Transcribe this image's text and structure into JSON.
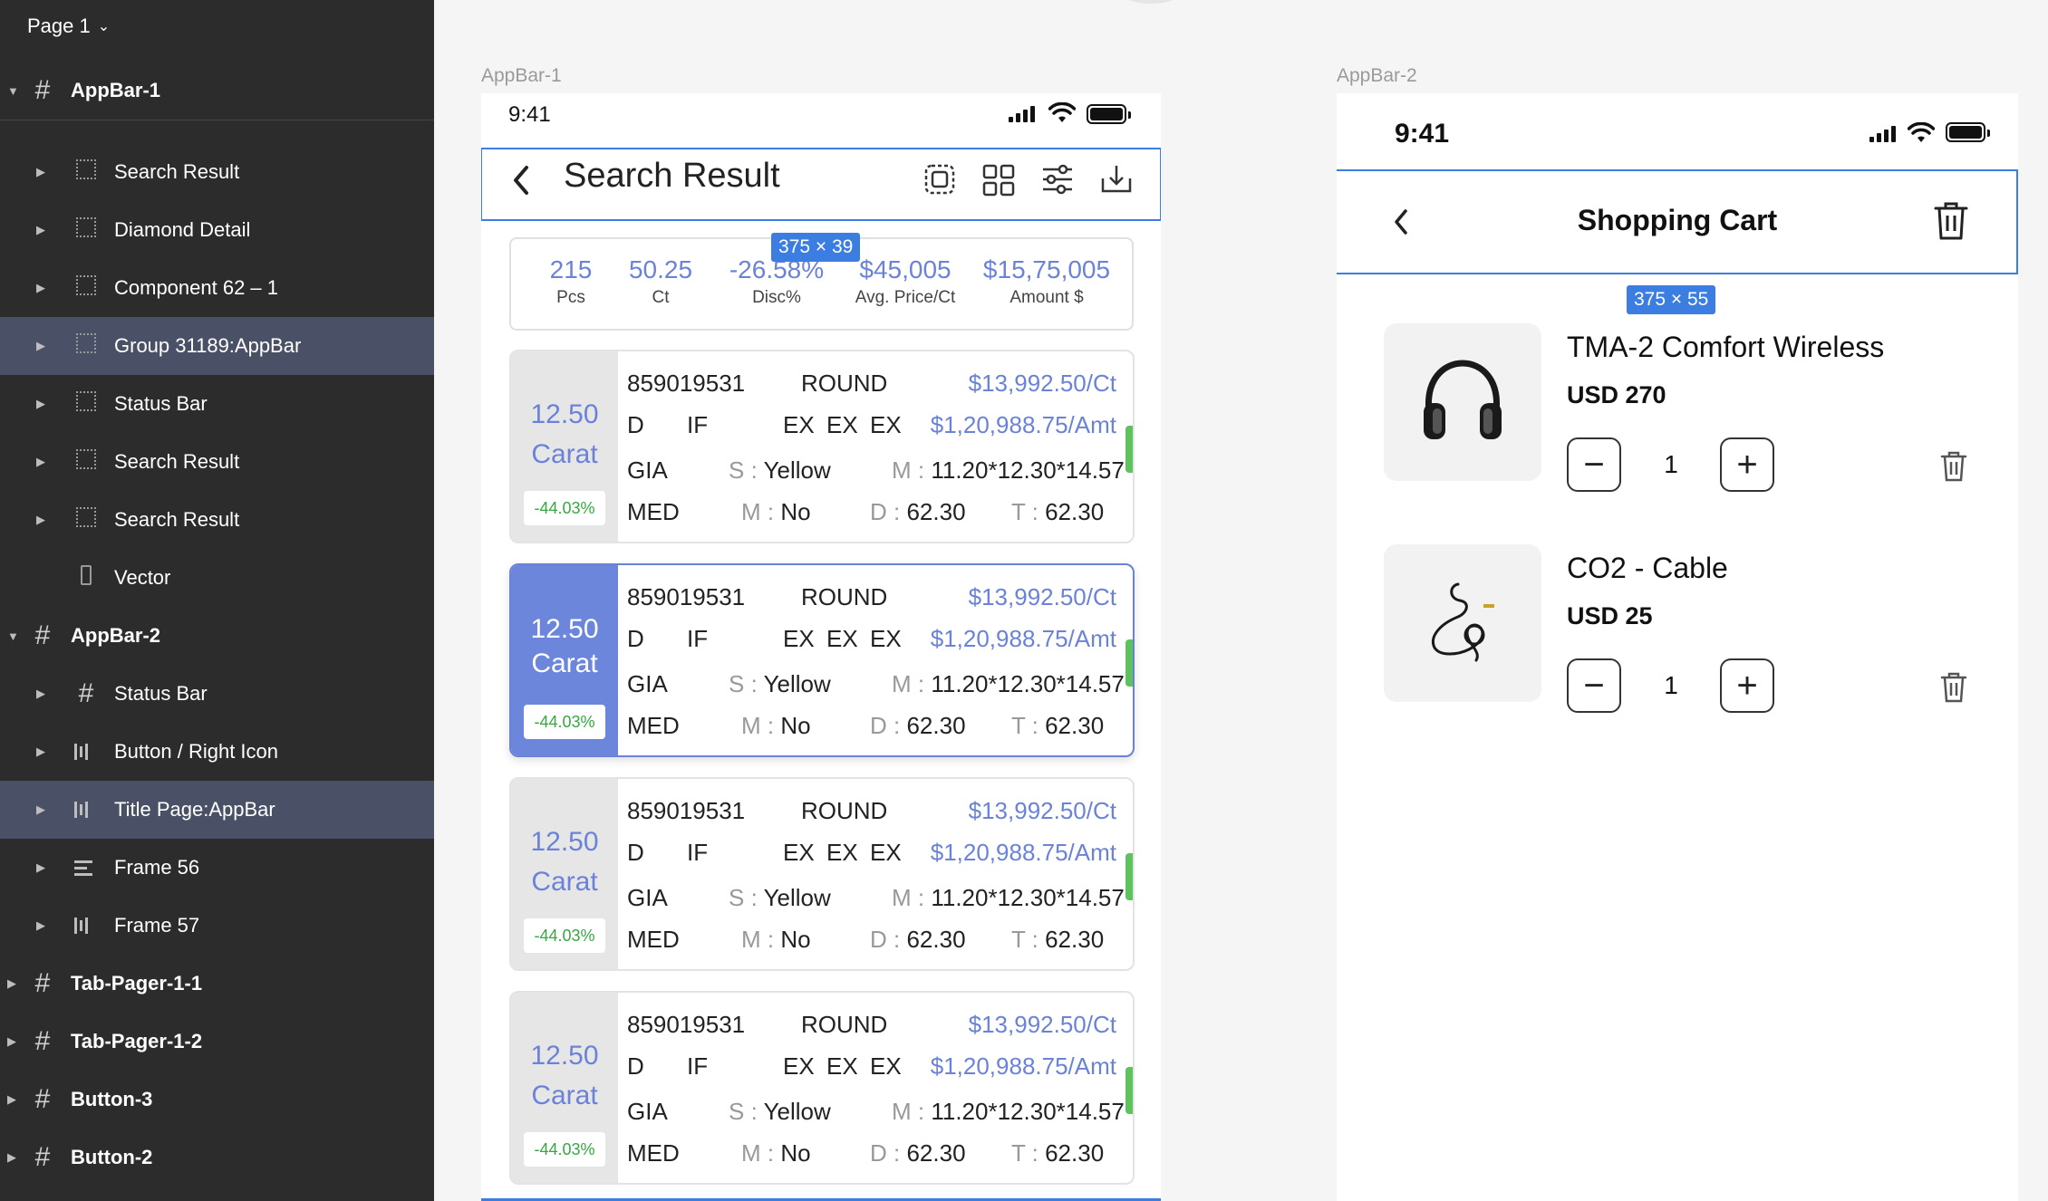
{
  "sidebar": {
    "page_label": "Page 1",
    "layers": [
      {
        "label": "AppBar-1",
        "icon": "frame-hash-icon",
        "level": 0,
        "expanded": true,
        "selected": false
      },
      {
        "label": "Search Result",
        "icon": "group-dotted-icon",
        "level": 1,
        "expanded": false,
        "selected": false
      },
      {
        "label": "Diamond Detail",
        "icon": "group-dotted-icon",
        "level": 1,
        "expanded": false,
        "selected": false
      },
      {
        "label": "Component 62 – 1",
        "icon": "group-dotted-icon",
        "level": 1,
        "expanded": false,
        "selected": false
      },
      {
        "label": "Group 31189:AppBar",
        "icon": "group-dotted-icon",
        "level": 1,
        "expanded": false,
        "selected": true
      },
      {
        "label": "Status Bar",
        "icon": "group-dotted-icon",
        "level": 1,
        "expanded": false,
        "selected": false
      },
      {
        "label": "Search Result",
        "icon": "group-dotted-icon",
        "level": 1,
        "expanded": false,
        "selected": false
      },
      {
        "label": "Search Result",
        "icon": "group-dotted-icon",
        "level": 1,
        "expanded": false,
        "selected": false
      },
      {
        "label": "Vector",
        "icon": "vector-icon",
        "level": 1,
        "expanded": null,
        "selected": false
      },
      {
        "label": "AppBar-2",
        "icon": "frame-hash-icon",
        "level": 0,
        "expanded": true,
        "selected": false
      },
      {
        "label": "Status Bar",
        "icon": "frame-hash-icon",
        "level": 1,
        "expanded": false,
        "selected": false
      },
      {
        "label": "Button / Right Icon",
        "icon": "auto-layout-horizontal-icon",
        "level": 1,
        "expanded": false,
        "selected": false
      },
      {
        "label": "Title Page:AppBar",
        "icon": "auto-layout-horizontal-icon",
        "level": 1,
        "expanded": false,
        "selected": true
      },
      {
        "label": "Frame 56",
        "icon": "auto-layout-vertical-icon",
        "level": 1,
        "expanded": false,
        "selected": false
      },
      {
        "label": "Frame 57",
        "icon": "auto-layout-horizontal-icon",
        "level": 1,
        "expanded": false,
        "selected": false
      },
      {
        "label": "Tab-Pager-1-1",
        "icon": "frame-hash-icon",
        "level": 0,
        "expanded": false,
        "selected": false
      },
      {
        "label": "Tab-Pager-1-2",
        "icon": "frame-hash-icon",
        "level": 0,
        "expanded": false,
        "selected": false
      },
      {
        "label": "Button-3",
        "icon": "frame-hash-icon",
        "level": 0,
        "expanded": false,
        "selected": false
      },
      {
        "label": "Button-2",
        "icon": "frame-hash-icon",
        "level": 0,
        "expanded": false,
        "selected": false
      }
    ]
  },
  "frame1": {
    "label": "AppBar-1",
    "status_time": "9:41",
    "title": "Search Result",
    "dimension_badge": "375 × 39",
    "icons": [
      "select-frame-icon",
      "grid-icon",
      "filter-sliders-icon",
      "download-icon"
    ],
    "summary": [
      {
        "value": "215",
        "unit": "Pcs"
      },
      {
        "value": "50.25",
        "unit": "Ct"
      },
      {
        "value": "-26.58%",
        "unit": "Disc%"
      },
      {
        "value": "$45,005",
        "unit": "Avg. Price/Ct"
      },
      {
        "value": "$15,75,005",
        "unit": "Amount $"
      }
    ],
    "results": [
      {
        "carat": "12.50",
        "carat_label": "Carat",
        "disc": "-44.03%",
        "id": "859019531",
        "shape": "ROUND",
        "price_ct": "$13,992.50/Ct",
        "color": "D",
        "clarity": "IF",
        "cut": "EX",
        "polish": "EX",
        "symmetry": "EX",
        "amount": "$1,20,988.75/Amt",
        "lab": "GIA",
        "s_label": "S :",
        "s_value": "Yellow",
        "m_label": "M :",
        "m_value": "11.20*12.30*14.57",
        "fluor": "MED",
        "m2_label": "M :",
        "m2_value": "No",
        "d_label": "D :",
        "d_value": "62.30",
        "t_label": "T :",
        "t_value": "62.30",
        "active": false
      },
      {
        "carat": "12.50",
        "carat_label": "Carat",
        "disc": "-44.03%",
        "id": "859019531",
        "shape": "ROUND",
        "price_ct": "$13,992.50/Ct",
        "color": "D",
        "clarity": "IF",
        "cut": "EX",
        "polish": "EX",
        "symmetry": "EX",
        "amount": "$1,20,988.75/Amt",
        "lab": "GIA",
        "s_label": "S :",
        "s_value": "Yellow",
        "m_label": "M :",
        "m_value": "11.20*12.30*14.57",
        "fluor": "MED",
        "m2_label": "M :",
        "m2_value": "No",
        "d_label": "D :",
        "d_value": "62.30",
        "t_label": "T :",
        "t_value": "62.30",
        "active": true
      },
      {
        "carat": "12.50",
        "carat_label": "Carat",
        "disc": "-44.03%",
        "id": "859019531",
        "shape": "ROUND",
        "price_ct": "$13,992.50/Ct",
        "color": "D",
        "clarity": "IF",
        "cut": "EX",
        "polish": "EX",
        "symmetry": "EX",
        "amount": "$1,20,988.75/Amt",
        "lab": "GIA",
        "s_label": "S :",
        "s_value": "Yellow",
        "m_label": "M :",
        "m_value": "11.20*12.30*14.57",
        "fluor": "MED",
        "m2_label": "M :",
        "m2_value": "No",
        "d_label": "D :",
        "d_value": "62.30",
        "t_label": "T :",
        "t_value": "62.30",
        "active": false
      },
      {
        "carat": "12.50",
        "carat_label": "Carat",
        "disc": "-44.03%",
        "id": "859019531",
        "shape": "ROUND",
        "price_ct": "$13,992.50/Ct",
        "color": "D",
        "clarity": "IF",
        "cut": "EX",
        "polish": "EX",
        "symmetry": "EX",
        "amount": "$1,20,988.75/Amt",
        "lab": "GIA",
        "s_label": "S :",
        "s_value": "Yellow",
        "m_label": "M :",
        "m_value": "11.20*12.30*14.57",
        "fluor": "MED",
        "m2_label": "M :",
        "m2_value": "No",
        "d_label": "D :",
        "d_value": "62.30",
        "t_label": "T :",
        "t_value": "62.30",
        "active": false
      }
    ]
  },
  "frame2": {
    "label": "AppBar-2",
    "status_time": "9:41",
    "title": "Shopping Cart",
    "dimension_badge": "375 × 55",
    "items": [
      {
        "name": "TMA-2 Comfort Wireless",
        "price": "USD 270",
        "qty": "1",
        "image": "headphones-icon"
      },
      {
        "name": "CO2 - Cable",
        "price": "USD 25",
        "qty": "1",
        "image": "cable-icon"
      }
    ]
  },
  "colors": {
    "selection_blue": "#3b7de0",
    "accent_blue": "#6a82d8",
    "discount_green": "#36a840",
    "sidebar_bg": "#2c2c2c",
    "sidebar_selected": "#4a5166"
  }
}
